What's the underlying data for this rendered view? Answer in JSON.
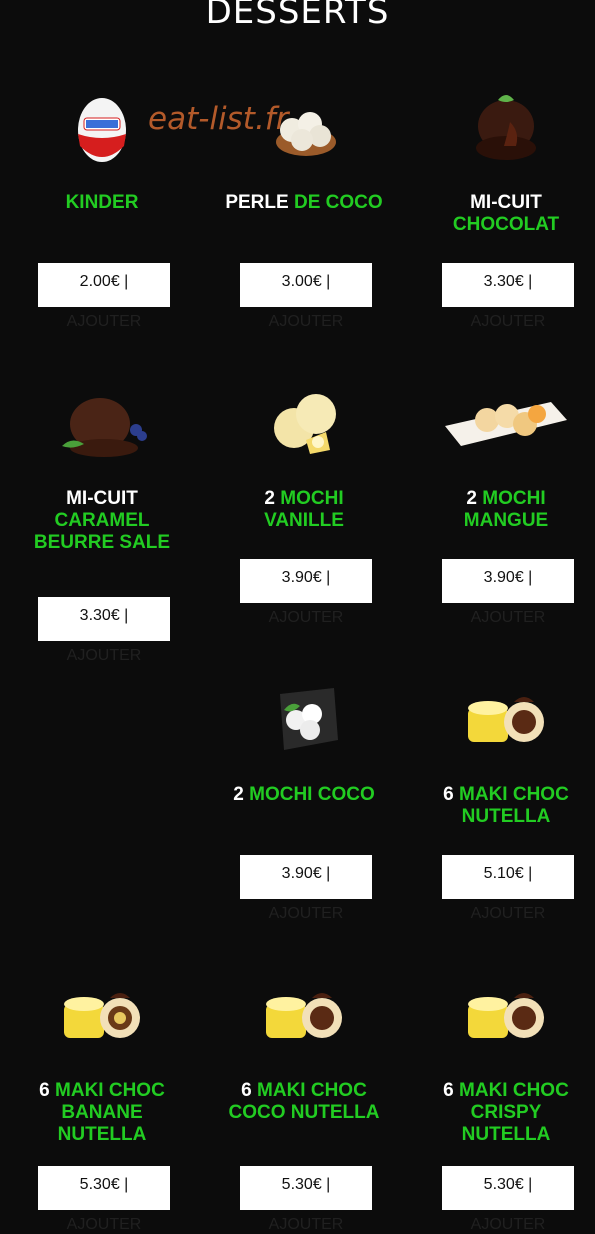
{
  "page": {
    "title": "DESSERTS",
    "watermark": "eat-list.fr"
  },
  "products": [
    {
      "name_white": "",
      "name_green": "KINDER",
      "price": "2.00€ |",
      "action": "AJOUTER",
      "icon": "kinder-egg-icon"
    },
    {
      "name_white": "PERLE",
      "name_green": "DE COCO",
      "price": "3.00€ |",
      "action": "AJOUTER",
      "icon": "coconut-pearls-icon"
    },
    {
      "name_white": "MI-CUIT",
      "name_green": "CHOCOLAT",
      "price": "3.30€ |",
      "action": "AJOUTER",
      "icon": "chocolate-lava-cake-icon"
    },
    {
      "name_white": "MI-CUIT",
      "name_green": "CARAMEL BEURRE SALE",
      "price": "3.30€ |",
      "action": "AJOUTER",
      "icon": "caramel-lava-cake-icon"
    },
    {
      "name_white": "2",
      "name_green": "MOCHI VANILLE",
      "price": "3.90€ |",
      "action": "AJOUTER",
      "icon": "mochi-vanilla-icon"
    },
    {
      "name_white": "2",
      "name_green": "MOCHI MANGUE",
      "price": "3.90€ |",
      "action": "AJOUTER",
      "icon": "mochi-mango-icon"
    },
    {
      "name_white": "2",
      "name_green": "MOCHI COCO",
      "price": "3.90€ |",
      "action": "AJOUTER",
      "icon": "mochi-coco-icon"
    },
    {
      "name_white": "6",
      "name_green": "MAKI CHOC NUTELLA",
      "price": "5.10€ |",
      "action": "AJOUTER",
      "icon": "maki-choc-icon"
    },
    {
      "name_white": "6",
      "name_green": "MAKI CHOC BANANE NUTELLA",
      "price": "5.30€ |",
      "action": "AJOUTER",
      "icon": "maki-choc-banana-icon"
    },
    {
      "name_white": "6",
      "name_green": "MAKI CHOC COCO NUTELLA",
      "price": "5.30€ |",
      "action": "AJOUTER",
      "icon": "maki-choc-coco-icon"
    },
    {
      "name_white": "6",
      "name_green": "MAKI CHOC CRISPY NUTELLA",
      "price": "5.30€ |",
      "action": "AJOUTER",
      "icon": "maki-choc-crispy-icon"
    }
  ]
}
